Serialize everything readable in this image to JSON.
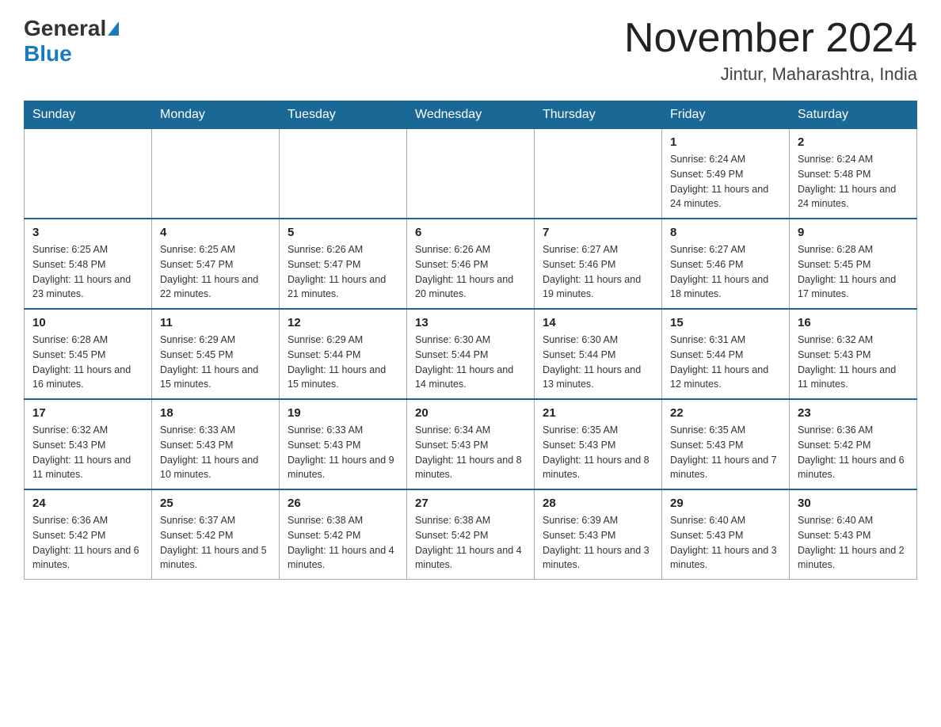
{
  "header": {
    "logo_general": "General",
    "logo_blue": "Blue",
    "month_year": "November 2024",
    "location": "Jintur, Maharashtra, India"
  },
  "days_of_week": [
    "Sunday",
    "Monday",
    "Tuesday",
    "Wednesday",
    "Thursday",
    "Friday",
    "Saturday"
  ],
  "weeks": [
    [
      {
        "day": "",
        "info": ""
      },
      {
        "day": "",
        "info": ""
      },
      {
        "day": "",
        "info": ""
      },
      {
        "day": "",
        "info": ""
      },
      {
        "day": "",
        "info": ""
      },
      {
        "day": "1",
        "info": "Sunrise: 6:24 AM\nSunset: 5:49 PM\nDaylight: 11 hours and 24 minutes."
      },
      {
        "day": "2",
        "info": "Sunrise: 6:24 AM\nSunset: 5:48 PM\nDaylight: 11 hours and 24 minutes."
      }
    ],
    [
      {
        "day": "3",
        "info": "Sunrise: 6:25 AM\nSunset: 5:48 PM\nDaylight: 11 hours and 23 minutes."
      },
      {
        "day": "4",
        "info": "Sunrise: 6:25 AM\nSunset: 5:47 PM\nDaylight: 11 hours and 22 minutes."
      },
      {
        "day": "5",
        "info": "Sunrise: 6:26 AM\nSunset: 5:47 PM\nDaylight: 11 hours and 21 minutes."
      },
      {
        "day": "6",
        "info": "Sunrise: 6:26 AM\nSunset: 5:46 PM\nDaylight: 11 hours and 20 minutes."
      },
      {
        "day": "7",
        "info": "Sunrise: 6:27 AM\nSunset: 5:46 PM\nDaylight: 11 hours and 19 minutes."
      },
      {
        "day": "8",
        "info": "Sunrise: 6:27 AM\nSunset: 5:46 PM\nDaylight: 11 hours and 18 minutes."
      },
      {
        "day": "9",
        "info": "Sunrise: 6:28 AM\nSunset: 5:45 PM\nDaylight: 11 hours and 17 minutes."
      }
    ],
    [
      {
        "day": "10",
        "info": "Sunrise: 6:28 AM\nSunset: 5:45 PM\nDaylight: 11 hours and 16 minutes."
      },
      {
        "day": "11",
        "info": "Sunrise: 6:29 AM\nSunset: 5:45 PM\nDaylight: 11 hours and 15 minutes."
      },
      {
        "day": "12",
        "info": "Sunrise: 6:29 AM\nSunset: 5:44 PM\nDaylight: 11 hours and 15 minutes."
      },
      {
        "day": "13",
        "info": "Sunrise: 6:30 AM\nSunset: 5:44 PM\nDaylight: 11 hours and 14 minutes."
      },
      {
        "day": "14",
        "info": "Sunrise: 6:30 AM\nSunset: 5:44 PM\nDaylight: 11 hours and 13 minutes."
      },
      {
        "day": "15",
        "info": "Sunrise: 6:31 AM\nSunset: 5:44 PM\nDaylight: 11 hours and 12 minutes."
      },
      {
        "day": "16",
        "info": "Sunrise: 6:32 AM\nSunset: 5:43 PM\nDaylight: 11 hours and 11 minutes."
      }
    ],
    [
      {
        "day": "17",
        "info": "Sunrise: 6:32 AM\nSunset: 5:43 PM\nDaylight: 11 hours and 11 minutes."
      },
      {
        "day": "18",
        "info": "Sunrise: 6:33 AM\nSunset: 5:43 PM\nDaylight: 11 hours and 10 minutes."
      },
      {
        "day": "19",
        "info": "Sunrise: 6:33 AM\nSunset: 5:43 PM\nDaylight: 11 hours and 9 minutes."
      },
      {
        "day": "20",
        "info": "Sunrise: 6:34 AM\nSunset: 5:43 PM\nDaylight: 11 hours and 8 minutes."
      },
      {
        "day": "21",
        "info": "Sunrise: 6:35 AM\nSunset: 5:43 PM\nDaylight: 11 hours and 8 minutes."
      },
      {
        "day": "22",
        "info": "Sunrise: 6:35 AM\nSunset: 5:43 PM\nDaylight: 11 hours and 7 minutes."
      },
      {
        "day": "23",
        "info": "Sunrise: 6:36 AM\nSunset: 5:42 PM\nDaylight: 11 hours and 6 minutes."
      }
    ],
    [
      {
        "day": "24",
        "info": "Sunrise: 6:36 AM\nSunset: 5:42 PM\nDaylight: 11 hours and 6 minutes."
      },
      {
        "day": "25",
        "info": "Sunrise: 6:37 AM\nSunset: 5:42 PM\nDaylight: 11 hours and 5 minutes."
      },
      {
        "day": "26",
        "info": "Sunrise: 6:38 AM\nSunset: 5:42 PM\nDaylight: 11 hours and 4 minutes."
      },
      {
        "day": "27",
        "info": "Sunrise: 6:38 AM\nSunset: 5:42 PM\nDaylight: 11 hours and 4 minutes."
      },
      {
        "day": "28",
        "info": "Sunrise: 6:39 AM\nSunset: 5:43 PM\nDaylight: 11 hours and 3 minutes."
      },
      {
        "day": "29",
        "info": "Sunrise: 6:40 AM\nSunset: 5:43 PM\nDaylight: 11 hours and 3 minutes."
      },
      {
        "day": "30",
        "info": "Sunrise: 6:40 AM\nSunset: 5:43 PM\nDaylight: 11 hours and 2 minutes."
      }
    ]
  ]
}
